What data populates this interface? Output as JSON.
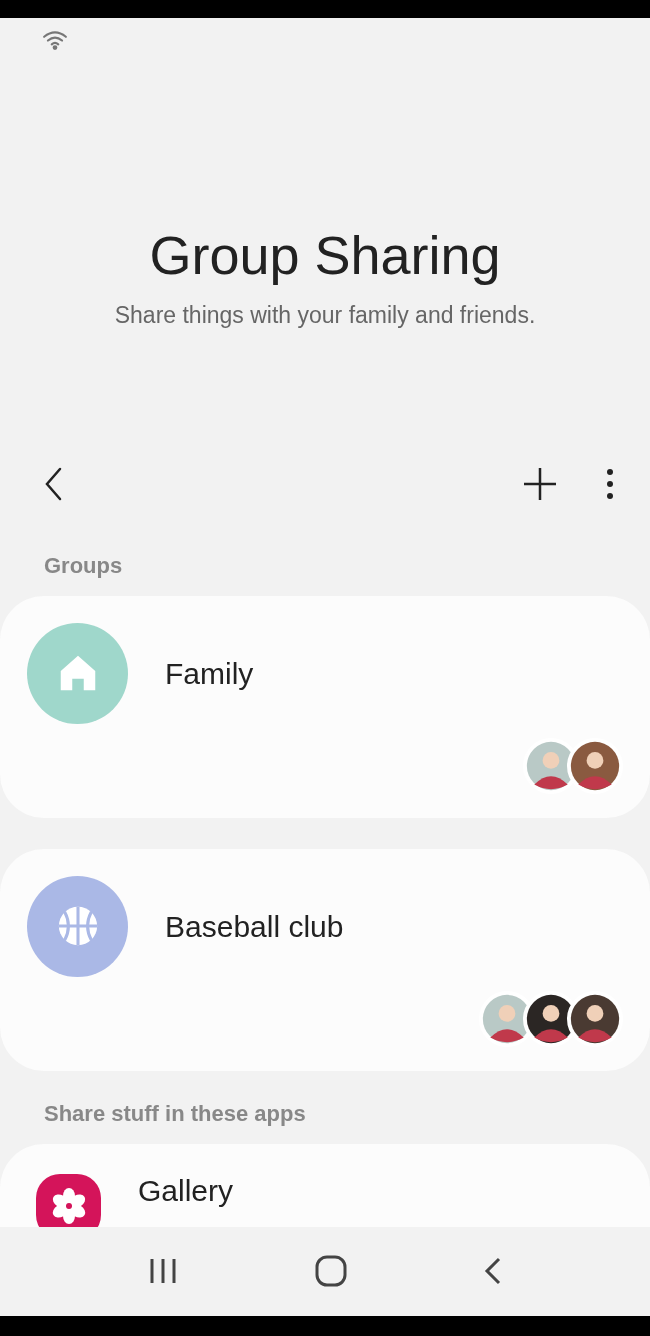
{
  "header": {
    "title": "Group Sharing",
    "subtitle": "Share things with your family and friends."
  },
  "groups_label": "Groups",
  "groups": [
    {
      "name": "Family",
      "kind": "home",
      "color": "#9fd7cb",
      "members": [
        {
          "color": "#b9c9c6"
        },
        {
          "color": "#8a5a40"
        }
      ]
    },
    {
      "name": "Baseball club",
      "kind": "ball",
      "color": "#aab8e6",
      "members": [
        {
          "color": "#b9c9c6"
        },
        {
          "color": "#2b2624"
        },
        {
          "color": "#4a3a32"
        }
      ]
    }
  ],
  "apps_label": "Share stuff in these apps",
  "apps": [
    {
      "name": "Gallery",
      "color": "#d4145a"
    }
  ]
}
